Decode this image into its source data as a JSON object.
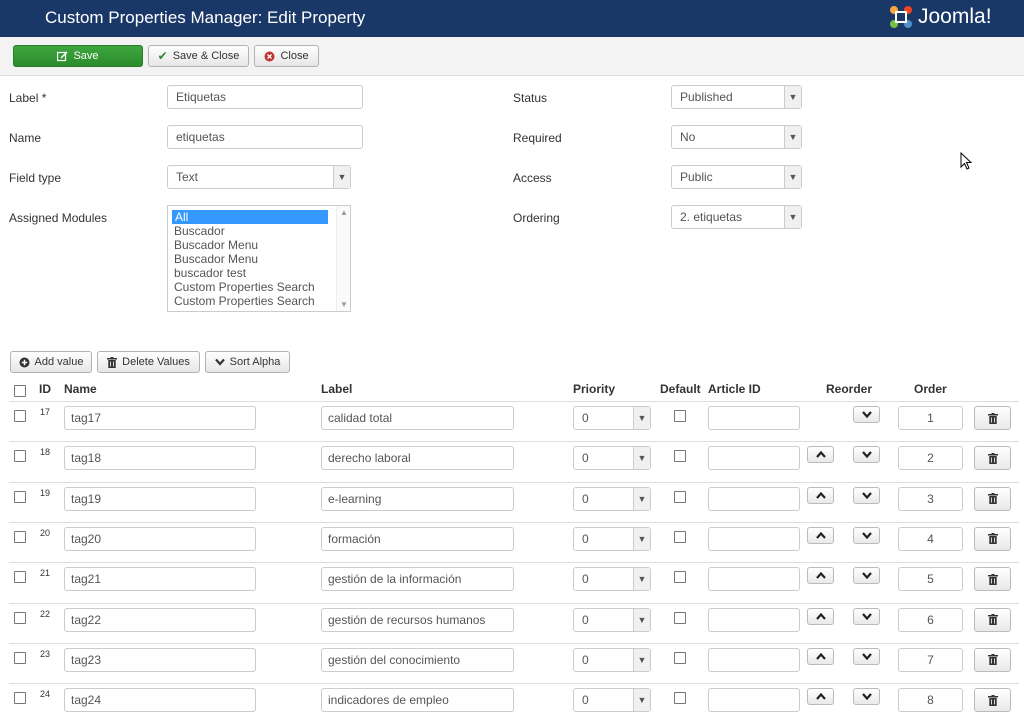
{
  "header": {
    "title": "Custom Properties Manager: Edit Property",
    "brand": "Joomla!"
  },
  "toolbar": {
    "save": "Save",
    "save_close": "Save & Close",
    "close": "Close"
  },
  "form": {
    "label_label": "Label *",
    "label_value": "Etiquetas",
    "name_label": "Name",
    "name_value": "etiquetas",
    "field_type_label": "Field type",
    "field_type_value": "Text",
    "assigned_modules_label": "Assigned Modules",
    "assigned_modules_options": [
      "All",
      "Buscador",
      "Buscador Menu",
      "Buscador Menu",
      "buscador test",
      "Custom Properties Search",
      "Custom Properties Search"
    ],
    "status_label": "Status",
    "status_value": "Published",
    "required_label": "Required",
    "required_value": "No",
    "access_label": "Access",
    "access_value": "Public",
    "ordering_label": "Ordering",
    "ordering_value": "2. etiquetas"
  },
  "values_toolbar": {
    "add": "Add value",
    "delete": "Delete Values",
    "sort": "Sort Alpha"
  },
  "table": {
    "headers": {
      "id": "ID",
      "name": "Name",
      "label": "Label",
      "priority": "Priority",
      "default": "Default",
      "article_id": "Article ID",
      "reorder": "Reorder",
      "order": "Order"
    },
    "rows": [
      {
        "id": "17",
        "name": "tag17",
        "label": "calidad total",
        "priority": "0",
        "order": "1"
      },
      {
        "id": "18",
        "name": "tag18",
        "label": "derecho laboral",
        "priority": "0",
        "order": "2"
      },
      {
        "id": "19",
        "name": "tag19",
        "label": "e-learning",
        "priority": "0",
        "order": "3"
      },
      {
        "id": "20",
        "name": "tag20",
        "label": "formación",
        "priority": "0",
        "order": "4"
      },
      {
        "id": "21",
        "name": "tag21",
        "label": "gestión de la información",
        "priority": "0",
        "order": "5"
      },
      {
        "id": "22",
        "name": "tag22",
        "label": "gestión de recursos humanos",
        "priority": "0",
        "order": "6"
      },
      {
        "id": "23",
        "name": "tag23",
        "label": "gestión del conocimiento",
        "priority": "0",
        "order": "7"
      },
      {
        "id": "24",
        "name": "tag24",
        "label": "indicadores de empleo",
        "priority": "0",
        "order": "8"
      }
    ]
  }
}
